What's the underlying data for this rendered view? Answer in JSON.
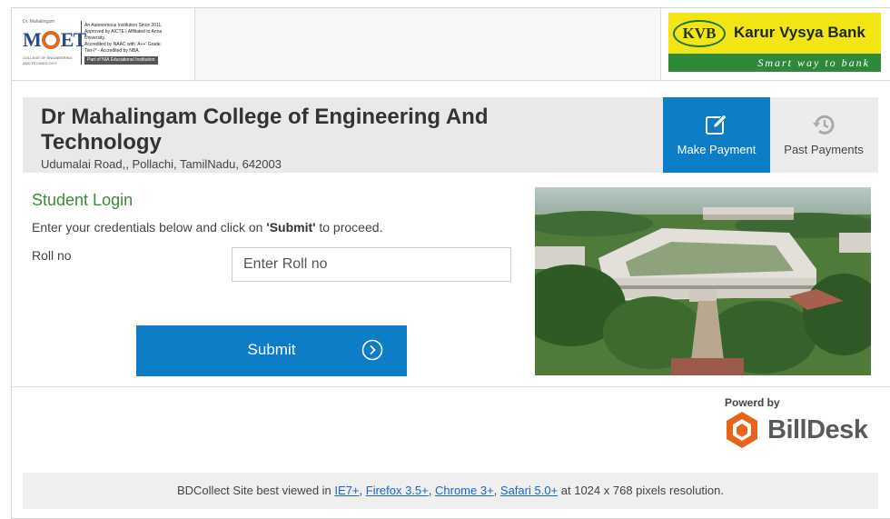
{
  "header": {
    "left_logo": {
      "name": "MCET",
      "tiny_top": "Dr. Mahalingam",
      "tiny_bottom": "COLLEGE OF ENGINEERING AND TECHNOLOGY",
      "lines": [
        "An Autonomous Institution Since 2011.",
        "Approved by AICTE | Affiliated to Anna University.",
        "Accredited by NAAC with 'A++' Grade.",
        "Tier-I* - Accredited by NBA."
      ],
      "tag": "Part of NIA Educational Institution"
    },
    "right_logo": {
      "badge": "KVB",
      "name": "Karur Vysya Bank",
      "tagline": "Smart way to bank"
    }
  },
  "college": {
    "name": "Dr Mahalingam College of Engineering And Technology",
    "address": "Udumalai Road,, Pollachi, TamilNadu, 642003"
  },
  "tabs": [
    {
      "label": "Make Payment",
      "icon": "edit-icon",
      "active": true
    },
    {
      "label": "Past Payments",
      "icon": "history-icon",
      "active": false
    }
  ],
  "login": {
    "title": "Student Login",
    "instructions_prefix": "Enter your credentials below and click on ",
    "instructions_bold": "'Submit'",
    "instructions_suffix": " to proceed.",
    "roll_label": "Roll no",
    "roll_placeholder": "Enter Roll no",
    "roll_value": "",
    "submit_label": "Submit"
  },
  "powered": {
    "label": "Powerd by",
    "brand": "BillDesk"
  },
  "footer": {
    "prefix": "BDCollect Site best viewed in ",
    "browsers": [
      "IE7+",
      "Firefox 3.5+",
      "Chrome 3+",
      "Safari 5.0+"
    ],
    "suffix": " at 1024 x 768 pixels resolution."
  },
  "colors": {
    "primary": "#0e7dc7",
    "login_title": "#3b8b3b",
    "billdesk_orange": "#e8641b",
    "kvb_yellow": "#f4e514",
    "kvb_green": "#2e8a3a"
  }
}
